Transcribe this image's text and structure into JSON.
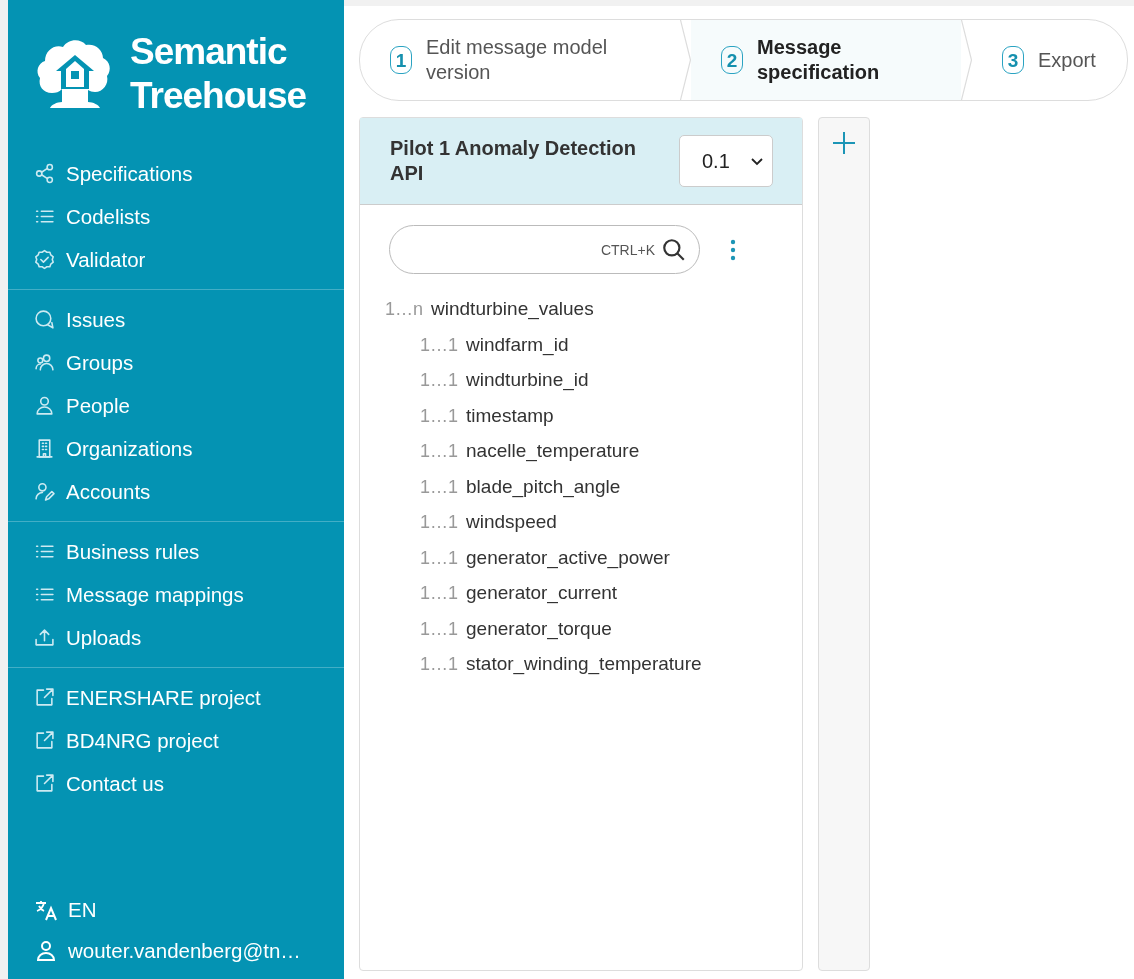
{
  "logo": {
    "line_1": "Semantic",
    "line_2": "Treehouse"
  },
  "sidebar": {
    "groups": [
      {
        "items": [
          {
            "label": "Specifications"
          },
          {
            "label": "Codelists"
          },
          {
            "label": "Validator"
          }
        ]
      },
      {
        "items": [
          {
            "label": "Issues"
          },
          {
            "label": "Groups"
          },
          {
            "label": "People"
          },
          {
            "label": "Organizations"
          },
          {
            "label": "Accounts"
          }
        ]
      },
      {
        "items": [
          {
            "label": "Business rules"
          },
          {
            "label": "Message mappings"
          },
          {
            "label": "Uploads"
          }
        ]
      },
      {
        "items": [
          {
            "label": "ENERSHARE project"
          },
          {
            "label": "BD4NRG project"
          },
          {
            "label": "Contact us"
          }
        ]
      }
    ],
    "language": "EN",
    "user": "wouter.vandenberg@tn…"
  },
  "steps": [
    {
      "number": "1",
      "label": "Edit message model version",
      "selected": false
    },
    {
      "number": "2",
      "label": "Message specification",
      "selected": true
    },
    {
      "number": "3",
      "label": "Export",
      "selected": false
    }
  ],
  "panel": {
    "title": "Pilot 1 Anomaly Detection API",
    "version": "0.1",
    "search": {
      "shortcut": "CTRL+K"
    },
    "tree": [
      {
        "multiplicity": "1…n",
        "name": "windturbine_values",
        "children": [
          {
            "multiplicity": "1…1",
            "name": "windfarm_id"
          },
          {
            "multiplicity": "1…1",
            "name": "windturbine_id"
          },
          {
            "multiplicity": "1…1",
            "name": "timestamp"
          },
          {
            "multiplicity": "1…1",
            "name": "nacelle_temperature"
          },
          {
            "multiplicity": "1…1",
            "name": "blade_pitch_angle"
          },
          {
            "multiplicity": "1…1",
            "name": "windspeed"
          },
          {
            "multiplicity": "1…1",
            "name": "generator_active_power"
          },
          {
            "multiplicity": "1…1",
            "name": "generator_current"
          },
          {
            "multiplicity": "1…1",
            "name": "generator_torque"
          },
          {
            "multiplicity": "1…1",
            "name": "stator_winding_temperature"
          }
        ]
      }
    ]
  }
}
